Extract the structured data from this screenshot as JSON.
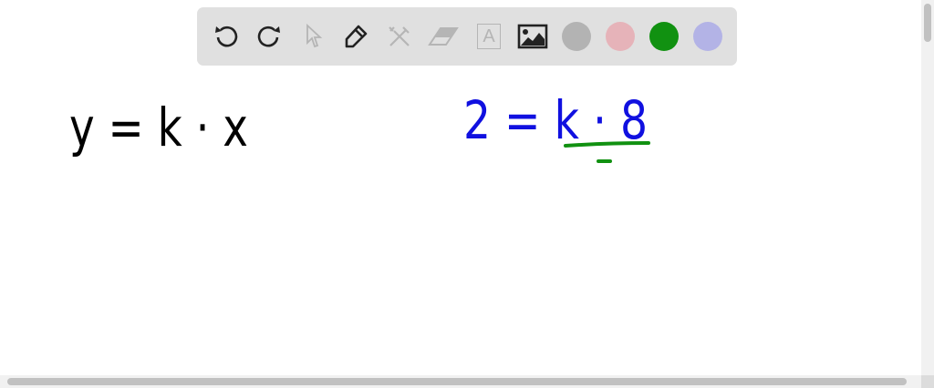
{
  "toolbar": {
    "tools": [
      {
        "name": "undo-icon",
        "enabled": true
      },
      {
        "name": "redo-icon",
        "enabled": true
      },
      {
        "name": "select-arrow-icon",
        "enabled": false
      },
      {
        "name": "pen-icon",
        "enabled": true
      },
      {
        "name": "tools-icon",
        "enabled": false
      },
      {
        "name": "eraser-icon",
        "enabled": false
      },
      {
        "name": "text-icon",
        "enabled": false,
        "label": "A"
      },
      {
        "name": "image-icon",
        "enabled": true
      }
    ],
    "colors": [
      "#b3b3b3",
      "#e6b3b9",
      "#119111",
      "#b3b3e6"
    ]
  },
  "canvas": {
    "handwriting": [
      {
        "text": "y = k · x",
        "color": "#000000"
      },
      {
        "text": "2 = k · 8",
        "color": "#1010e0"
      },
      {
        "text": "underline",
        "color": "#119111"
      }
    ]
  }
}
